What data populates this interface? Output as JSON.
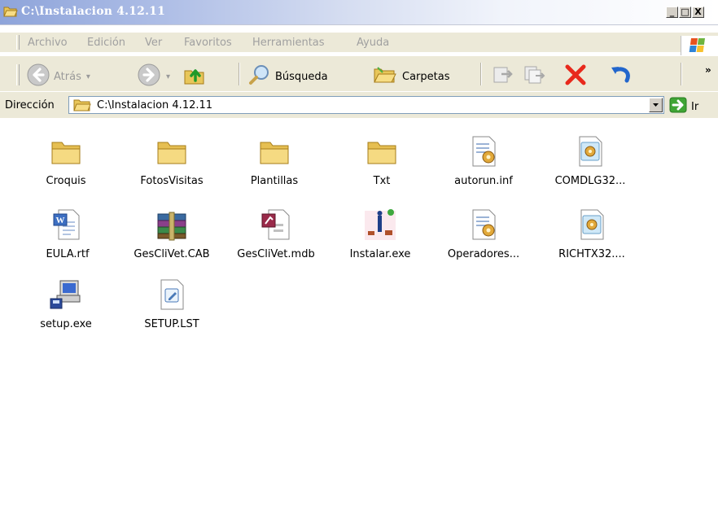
{
  "window": {
    "title": "C:\\Instalacion 4.12.11",
    "controls": [
      "_",
      "□",
      "X"
    ]
  },
  "menu": {
    "items": [
      "Archivo",
      "Edición",
      "Ver",
      "Favoritos",
      "Herramientas",
      "Ayuda"
    ]
  },
  "toolbar": {
    "back_label": "Atrás",
    "search_label": "Búsqueda",
    "folders_label": "Carpetas",
    "more": "»"
  },
  "address": {
    "label": "Dirección",
    "value": "C:\\Instalacion 4.12.11",
    "go_label": "Ir"
  },
  "files": [
    {
      "name": "Croquis",
      "icon": "folder-icon"
    },
    {
      "name": "FotosVisitas",
      "icon": "folder-icon"
    },
    {
      "name": "Plantillas",
      "icon": "folder-icon"
    },
    {
      "name": "Txt",
      "icon": "folder-icon"
    },
    {
      "name": "autorun.inf",
      "icon": "config-file-icon"
    },
    {
      "name": "COMDLG32...",
      "icon": "system-file-icon"
    },
    {
      "name": "EULA.rtf",
      "icon": "word-document-icon"
    },
    {
      "name": "GesCliVet.CAB",
      "icon": "cabinet-archive-icon"
    },
    {
      "name": "GesCliVet.mdb",
      "icon": "access-database-icon"
    },
    {
      "name": "Instalar.exe",
      "icon": "application-icon"
    },
    {
      "name": "Operadores...",
      "icon": "config-file-icon"
    },
    {
      "name": "RICHTX32....",
      "icon": "system-file-icon"
    },
    {
      "name": "setup.exe",
      "icon": "setup-icon"
    },
    {
      "name": "SETUP.LST",
      "icon": "text-file-icon"
    }
  ]
}
